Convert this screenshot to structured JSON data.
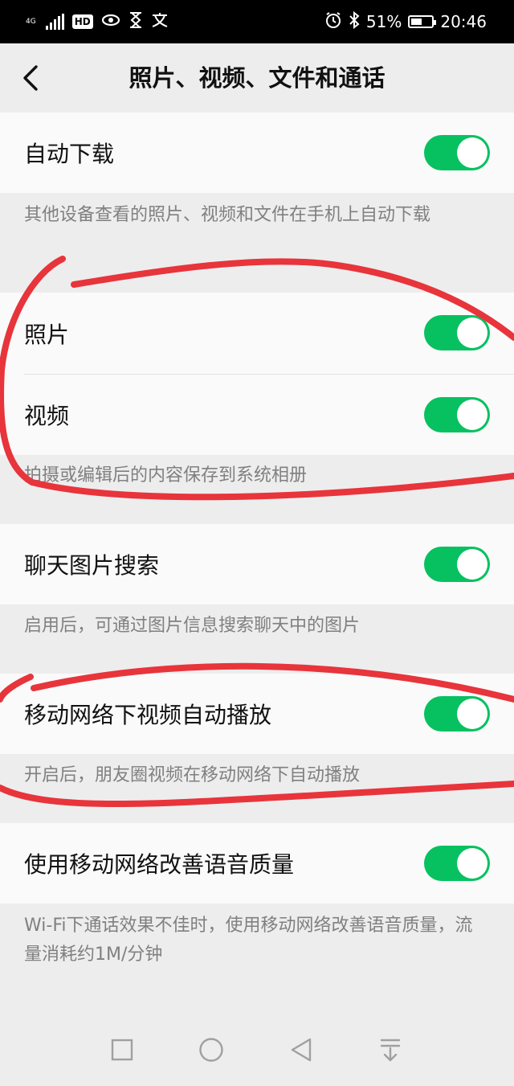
{
  "status_bar": {
    "network": "4G",
    "hd_badge": "HD",
    "battery_percent": "51%",
    "battery_level": 0.51,
    "time": "20:46",
    "icons": [
      "signal-icon",
      "eye-icon",
      "hourglass-icon",
      "translate-icon",
      "alarm-icon",
      "bluetooth-icon",
      "battery-icon"
    ]
  },
  "nav": {
    "title": "照片、视频、文件和通话",
    "back_icon": "chevron-left-icon"
  },
  "settings": {
    "auto_download": {
      "label": "自动下载",
      "enabled": true,
      "description": "其他设备查看的照片、视频和文件在手机上自动下载"
    },
    "photos": {
      "label": "照片",
      "enabled": true
    },
    "videos": {
      "label": "视频",
      "enabled": true
    },
    "save_description": "拍摄或编辑后的内容保存到系统相册",
    "chat_image_search": {
      "label": "聊天图片搜索",
      "enabled": true,
      "description": "启用后，可通过图片信息搜索聊天中的图片"
    },
    "mobile_autoplay": {
      "label": "移动网络下视频自动播放",
      "enabled": true,
      "description": "开启后，朋友圈视频在移动网络下自动播放"
    },
    "mobile_voice_quality": {
      "label": "使用移动网络改善语音质量",
      "enabled": true,
      "description": "Wi-Fi下通话效果不佳时，使用移动网络改善语音质量，流量消耗约1M/分钟"
    }
  },
  "system_nav": {
    "buttons": [
      "square-recents-icon",
      "circle-home-icon",
      "triangle-back-icon",
      "notification-pull-icon"
    ]
  },
  "colors": {
    "toggle_on": "#07c160",
    "background": "#ededed",
    "row_background": "#fafafa",
    "annotation": "#e8343b"
  }
}
